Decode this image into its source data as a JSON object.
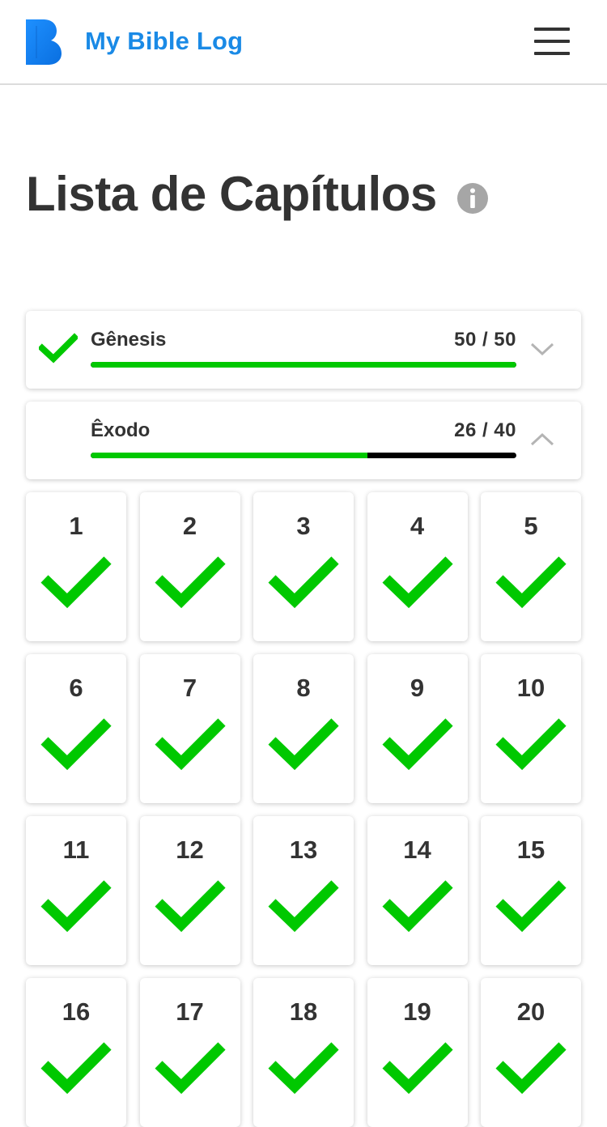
{
  "header": {
    "app_title": "My Bible Log",
    "logo_icon": "bible-log-logo",
    "menu_icon": "hamburger-menu-icon"
  },
  "page": {
    "title": "Lista de Capítulos",
    "info_icon": "info-icon"
  },
  "colors": {
    "brand": "#1a8ae6",
    "progress": "#00c800",
    "progress_track": "#000000",
    "text": "#333333"
  },
  "books": [
    {
      "name": "Gênesis",
      "count": "50 / 50",
      "read": 50,
      "total": 50,
      "progress": 1.0,
      "completed": true,
      "expanded": false,
      "chevron": "chevron-down-icon"
    },
    {
      "name": "Êxodo",
      "count": "26 / 40",
      "read": 26,
      "total": 40,
      "progress": 0.65,
      "completed": false,
      "expanded": true,
      "chevron": "chevron-up-icon"
    }
  ],
  "chapters": [
    {
      "number": "1",
      "read": true
    },
    {
      "number": "2",
      "read": true
    },
    {
      "number": "3",
      "read": true
    },
    {
      "number": "4",
      "read": true
    },
    {
      "number": "5",
      "read": true
    },
    {
      "number": "6",
      "read": true
    },
    {
      "number": "7",
      "read": true
    },
    {
      "number": "8",
      "read": true
    },
    {
      "number": "9",
      "read": true
    },
    {
      "number": "10",
      "read": true
    },
    {
      "number": "11",
      "read": true
    },
    {
      "number": "12",
      "read": true
    },
    {
      "number": "13",
      "read": true
    },
    {
      "number": "14",
      "read": true
    },
    {
      "number": "15",
      "read": true
    },
    {
      "number": "16",
      "read": true
    },
    {
      "number": "17",
      "read": true
    },
    {
      "number": "18",
      "read": true
    },
    {
      "number": "19",
      "read": true
    },
    {
      "number": "20",
      "read": true
    }
  ]
}
